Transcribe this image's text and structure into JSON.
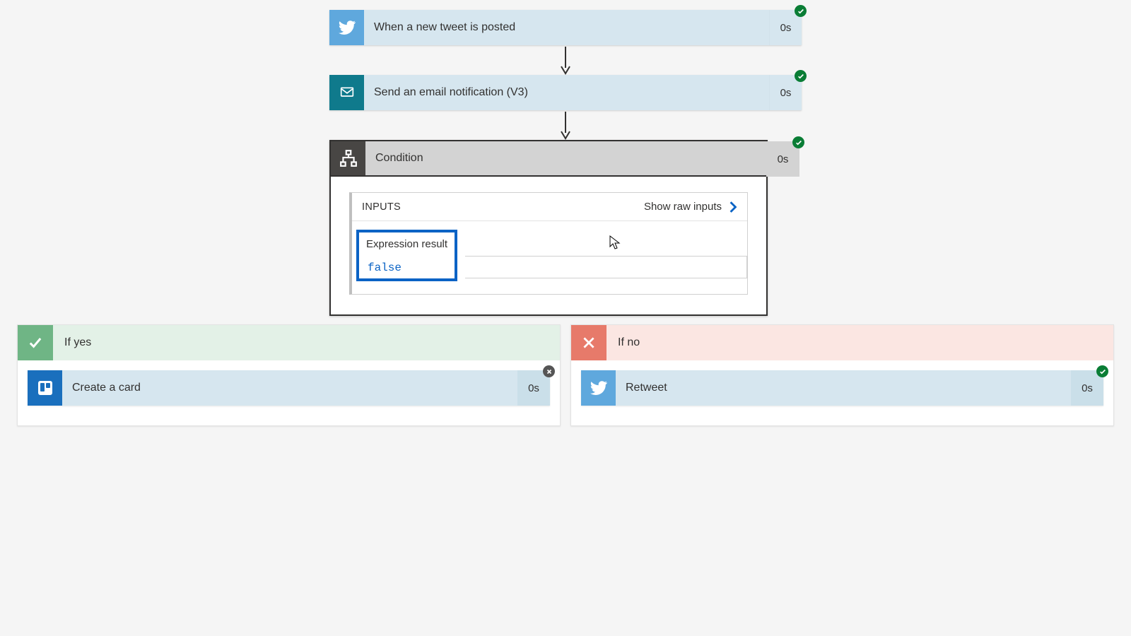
{
  "flow": {
    "step1": {
      "label": "When a new tweet is posted",
      "duration": "0s",
      "status": "success"
    },
    "step2": {
      "label": "Send an email notification (V3)",
      "duration": "0s",
      "status": "success"
    },
    "condition": {
      "label": "Condition",
      "duration": "0s",
      "status": "success",
      "inputs_title": "INPUTS",
      "show_raw_label": "Show raw inputs",
      "expression_label": "Expression result",
      "expression_value": "false"
    },
    "branches": {
      "yes": {
        "header": "If yes",
        "action": {
          "label": "Create a card",
          "duration": "0s",
          "status": "fail"
        }
      },
      "no": {
        "header": "If no",
        "action": {
          "label": "Retweet",
          "duration": "0s",
          "status": "success"
        }
      }
    }
  },
  "colors": {
    "twitter": "#5fa8dd",
    "email": "#0f7a8c",
    "condition": "#484644",
    "trello": "#1a6fbd",
    "highlight": "#0b63c5",
    "success": "#0a7d35",
    "yes": "#6fb585",
    "no": "#e77a6a"
  }
}
